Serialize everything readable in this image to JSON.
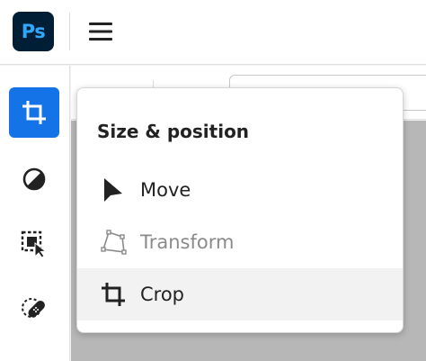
{
  "app": {
    "logo_text": "Ps"
  },
  "colors": {
    "accent": "#1473e6",
    "logo_bg": "#001e36",
    "logo_fg": "#31a8ff",
    "disabled_text": "#8a8a8a"
  },
  "toolbar": {
    "tools": [
      {
        "icon": "crop-icon",
        "active": true
      },
      {
        "icon": "adjustment-icon",
        "active": false
      },
      {
        "icon": "selection-icon",
        "active": false
      },
      {
        "icon": "healing-bandage-icon",
        "active": false
      }
    ]
  },
  "popover": {
    "title": "Size & position",
    "items": [
      {
        "label": "Move",
        "icon": "move-arrow-icon",
        "disabled": false
      },
      {
        "label": "Transform",
        "icon": "transform-icon",
        "disabled": true
      },
      {
        "label": "Crop",
        "icon": "crop-icon",
        "disabled": false,
        "hovered": true
      }
    ]
  }
}
